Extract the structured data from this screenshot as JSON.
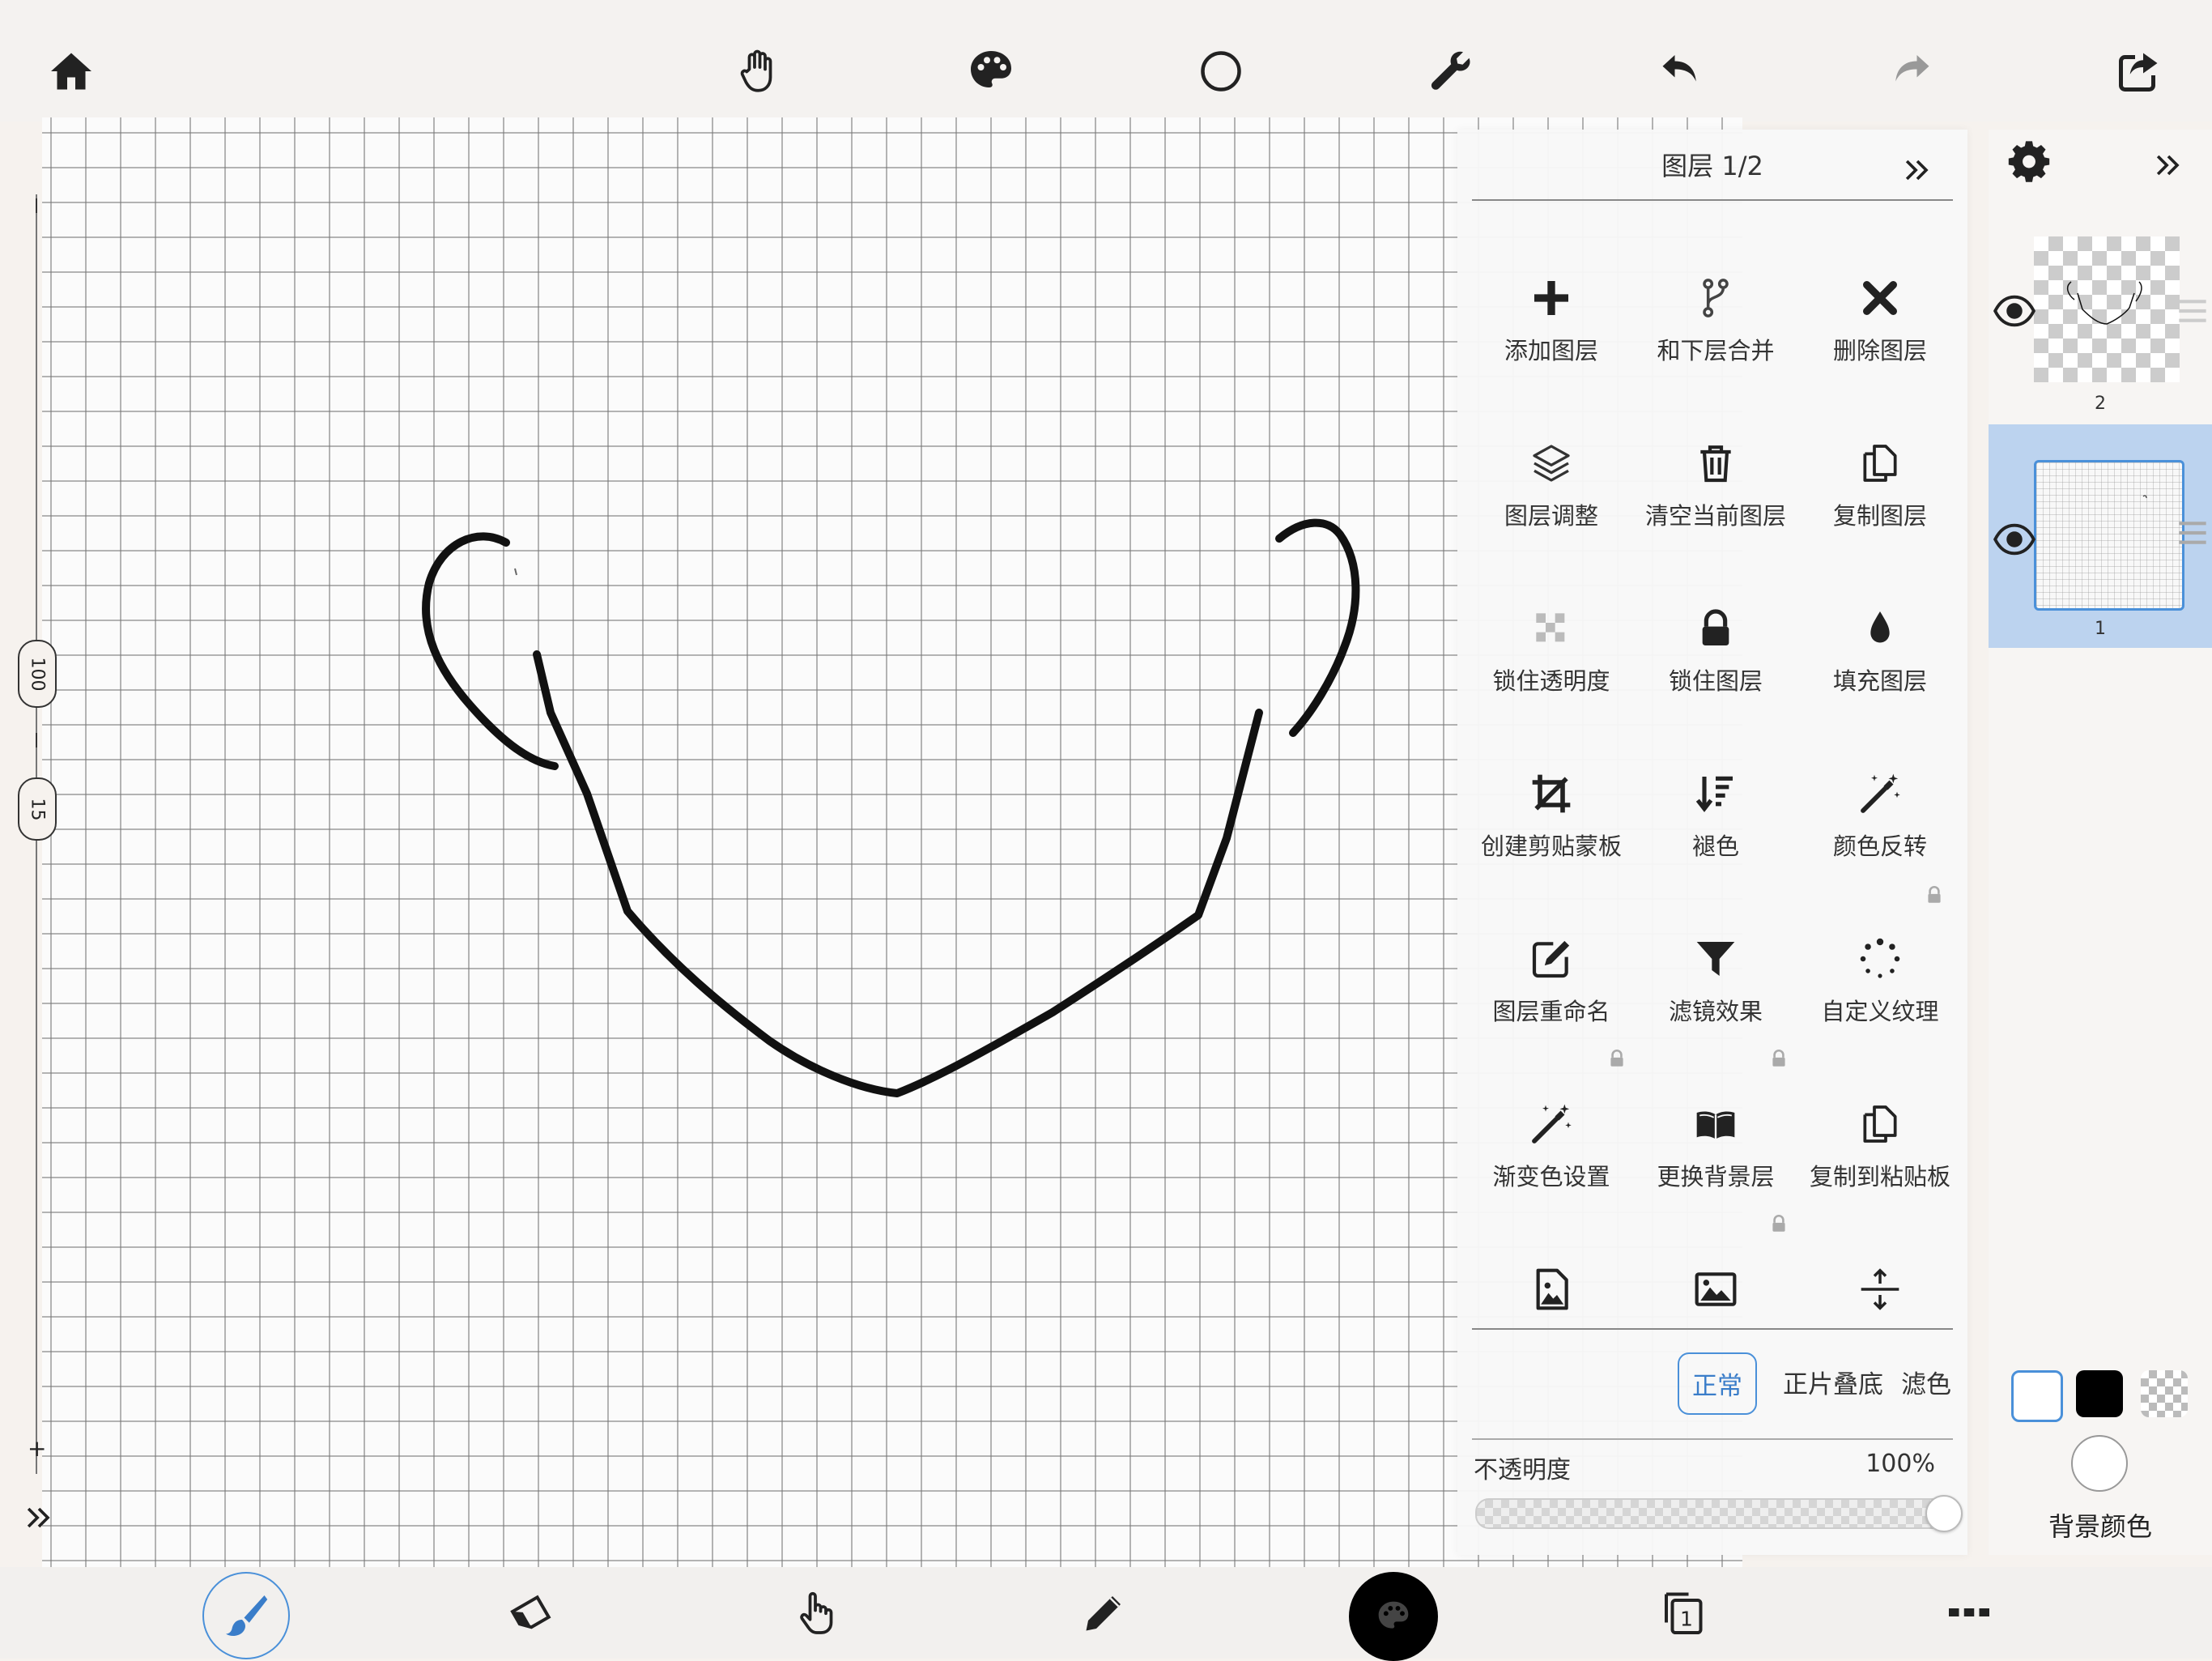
{
  "layer_panel": {
    "title": "图层 1/2",
    "actions": [
      {
        "label": "添加图层",
        "icon": "plus-icon",
        "locked": false
      },
      {
        "label": "和下层合并",
        "icon": "merge-icon",
        "locked": false
      },
      {
        "label": "删除图层",
        "icon": "close-icon",
        "locked": false
      },
      {
        "label": "图层调整",
        "icon": "layers-icon",
        "locked": false
      },
      {
        "label": "清空当前图层",
        "icon": "trash-icon",
        "locked": false
      },
      {
        "label": "复制图层",
        "icon": "copy-icon",
        "locked": false
      },
      {
        "label": "锁住透明度",
        "icon": "checker-icon",
        "locked": false
      },
      {
        "label": "锁住图层",
        "icon": "lock-icon",
        "locked": false
      },
      {
        "label": "填充图层",
        "icon": "drop-icon",
        "locked": false
      },
      {
        "label": "创建剪贴蒙板",
        "icon": "crop-icon",
        "locked": false
      },
      {
        "label": "褪色",
        "icon": "sort-down-icon",
        "locked": false
      },
      {
        "label": "颜色反转",
        "icon": "magic-wand-icon",
        "locked": true
      },
      {
        "label": "图层重命名",
        "icon": "edit-icon",
        "locked": true
      },
      {
        "label": "滤镜效果",
        "icon": "filter-icon",
        "locked": true
      },
      {
        "label": "自定义纹理",
        "icon": "dots-circle-icon",
        "locked": false
      },
      {
        "label": "渐变色设置",
        "icon": "magic-wand-icon",
        "locked": false
      },
      {
        "label": "更换背景层",
        "icon": "book-icon",
        "locked": true
      },
      {
        "label": "复制到粘贴板",
        "icon": "copy-icon",
        "locked": false
      },
      {
        "label": "",
        "icon": "image-file-icon",
        "locked": false
      },
      {
        "label": "",
        "icon": "image-icon",
        "locked": false
      },
      {
        "label": "",
        "icon": "split-arrows-icon",
        "locked": false
      }
    ],
    "blend_modes": [
      "正常",
      "正片叠底",
      "滤色"
    ],
    "blend_selected": "正常",
    "opacity_label": "不透明度",
    "opacity_value": "100%",
    "opacity_fraction": 1.0
  },
  "layers": [
    {
      "number": "2",
      "visible": true,
      "selected": false
    },
    {
      "number": "1",
      "visible": true,
      "selected": true
    }
  ],
  "colors": {
    "primary_swatch": "#ffffff",
    "secondary_swatch": "#000000",
    "background_color": "#ffffff",
    "accent": "#4a90d9",
    "selected_layer": "#bcd3ef"
  },
  "background_color_label": "背景颜色",
  "ruler": {
    "zoom": "100",
    "size": "15"
  },
  "top_toolbar": [
    "home-icon",
    "hand-icon",
    "palette-icon",
    "circle-icon",
    "wrench-icon",
    "undo-icon",
    "redo-icon",
    "share-icon"
  ],
  "bottom_toolbar": [
    "brush-icon",
    "eraser-icon",
    "hand-pointer-icon",
    "pencil-icon",
    "color-picker-icon",
    "layers-count-icon",
    "more-icon"
  ],
  "layer_count_badge": "1"
}
